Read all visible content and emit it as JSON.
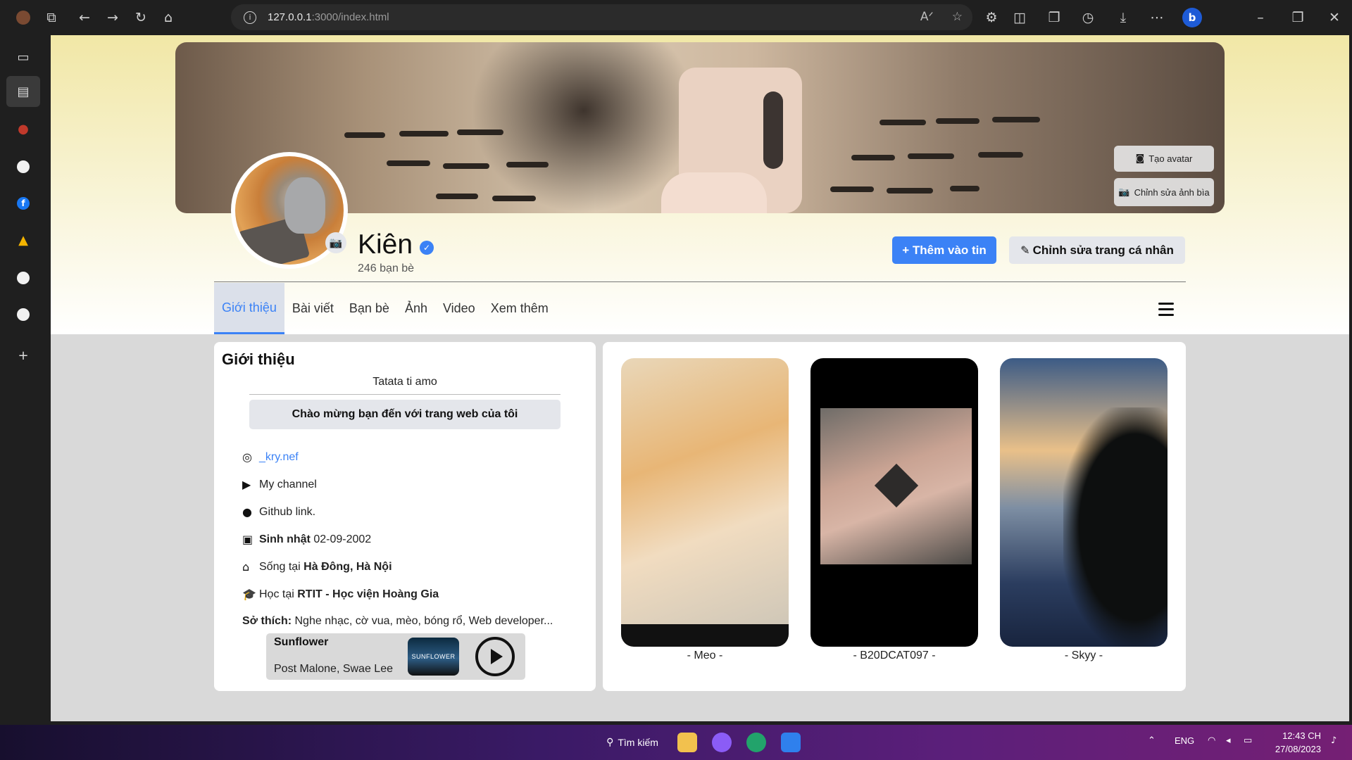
{
  "browser": {
    "url_host": "127.0.0.1",
    "url_rest": ":3000/index.html"
  },
  "cover": {
    "create_avatar_label": "Tạo avatar",
    "edit_cover_label": "Chỉnh sửa ảnh bìa"
  },
  "profile": {
    "name": "Kiên",
    "friends": "246 bạn bè",
    "add_story_label": "+ Thêm vào tin",
    "edit_profile_label": "Chỉnh sửa trang cá nhân"
  },
  "nav": {
    "tabs": [
      {
        "label": "Giới thiệu"
      },
      {
        "label": "Bài viết"
      },
      {
        "label": "Bạn bè"
      },
      {
        "label": "Ảnh"
      },
      {
        "label": "Video"
      },
      {
        "label": "Xem thêm"
      }
    ]
  },
  "intro": {
    "title": "Giới thiệu",
    "bio": "Tatata ti amo",
    "welcome": "Chào mừng bạn đến với trang web của tôi",
    "instagram": "_kry.nef",
    "youtube": "My channel",
    "github": "Github link.",
    "birthday_label": "Sinh nhật",
    "birthday_value": "02-09-2002",
    "lives_prefix": "Sống tại",
    "lives_value": "Hà Đông, Hà Nội",
    "study_prefix": "Học tại",
    "study_value": "RTIT - Học viện Hoàng Gia",
    "hobby_label": "Sở thích:",
    "hobby_value": "Nghe nhạc, cờ vua, mèo, bóng rổ, Web developer...",
    "music": {
      "song": "Sunflower",
      "artist": "Post Malone, Swae Lee",
      "cover_text": "SUNFLOWER"
    }
  },
  "photos": [
    {
      "caption": "- Meo -"
    },
    {
      "caption": "- B20DCAT097 -"
    },
    {
      "caption": "- Skyy -"
    }
  ],
  "taskbar": {
    "search_label": "Tìm kiếm",
    "lang": "ENG",
    "time": "12:43 CH",
    "date": "27/08/2023"
  }
}
